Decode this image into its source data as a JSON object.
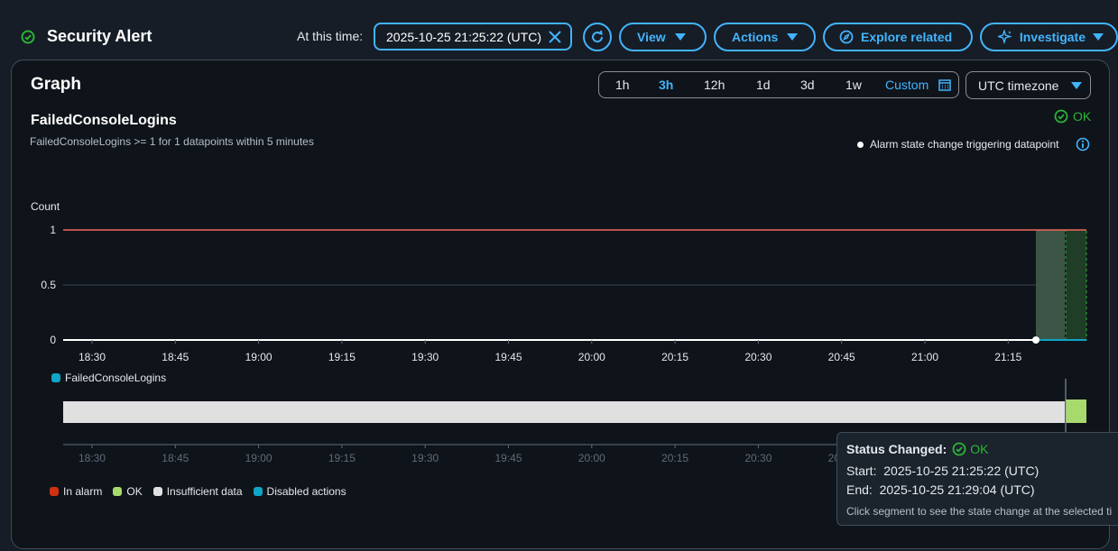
{
  "header": {
    "title": "Security Alert",
    "at_label": "At this time:",
    "time_value": "2025-10-25 21:25:22 (UTC)",
    "buttons": {
      "view": "View",
      "actions": "Actions",
      "explore": "Explore related",
      "investigate": "Investigate"
    }
  },
  "graph": {
    "title": "Graph",
    "ranges": [
      "1h",
      "3h",
      "12h",
      "1d",
      "3d",
      "1w"
    ],
    "selected_range": "3h",
    "custom": "Custom",
    "timezone": "UTC timezone"
  },
  "metric": {
    "name": "FailedConsoleLogins",
    "condition": "FailedConsoleLogins >= 1 for 1 datapoints within 5 minutes",
    "state": "OK",
    "trigger_note": "Alarm state change triggering datapoint"
  },
  "chart_data": {
    "type": "line",
    "ylabel": "Count",
    "yticks": [
      "1",
      "0.5",
      "0"
    ],
    "ylim": [
      0,
      1
    ],
    "threshold": 1,
    "x_ticks": [
      "18:30",
      "18:45",
      "19:00",
      "19:15",
      "19:30",
      "19:45",
      "20:00",
      "20:15",
      "20:30",
      "20:45",
      "21:00",
      "21:15"
    ],
    "series": [
      {
        "name": "FailedConsoleLogins",
        "color": "#0ea5c8",
        "values": [
          0
        ]
      }
    ],
    "state_bands": [
      {
        "state": "Insufficient data",
        "color": "#e0e0e0"
      },
      {
        "state": "OK",
        "color": "#a8d96c"
      }
    ]
  },
  "legend_states": [
    {
      "label": "In alarm",
      "color": "#d13212"
    },
    {
      "label": "OK",
      "color": "#a8d96c"
    },
    {
      "label": "Insufficient data",
      "color": "#e0e0e0"
    },
    {
      "label": "Disabled actions",
      "color": "#0ea5c8"
    }
  ],
  "tooltip": {
    "title": "Status Changed:",
    "state": "OK",
    "start_label": "Start:",
    "start": "2025-10-25 21:25:22 (UTC)",
    "end_label": "End:",
    "end": "2025-10-25 21:29:04 (UTC)",
    "hint": "Click segment to see the state change at the selected ti"
  }
}
